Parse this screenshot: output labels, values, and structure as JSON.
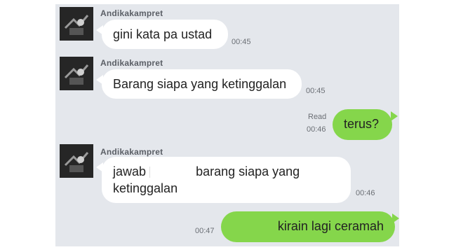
{
  "chat": {
    "messages": [
      {
        "sender": "Andikakampret",
        "text": "gini kata pa ustad",
        "time": "00:45"
      },
      {
        "sender": "Andikakampret",
        "text": "Barang siapa yang ketinggalan",
        "time": "00:45"
      },
      {
        "text": "terus?",
        "time": "00:46",
        "status": "Read"
      },
      {
        "sender": "Andikakampret",
        "text_line1_start": "jawab",
        "text_line1_end": "barang siapa yang",
        "text_line2": "ketinggalan",
        "time": "00:46"
      },
      {
        "text": "kirain lagi ceramah",
        "time": "00:47"
      }
    ]
  },
  "colors": {
    "background": "#e4e7ec",
    "incoming_bubble": "#ffffff",
    "outgoing_bubble": "#85d64b"
  }
}
